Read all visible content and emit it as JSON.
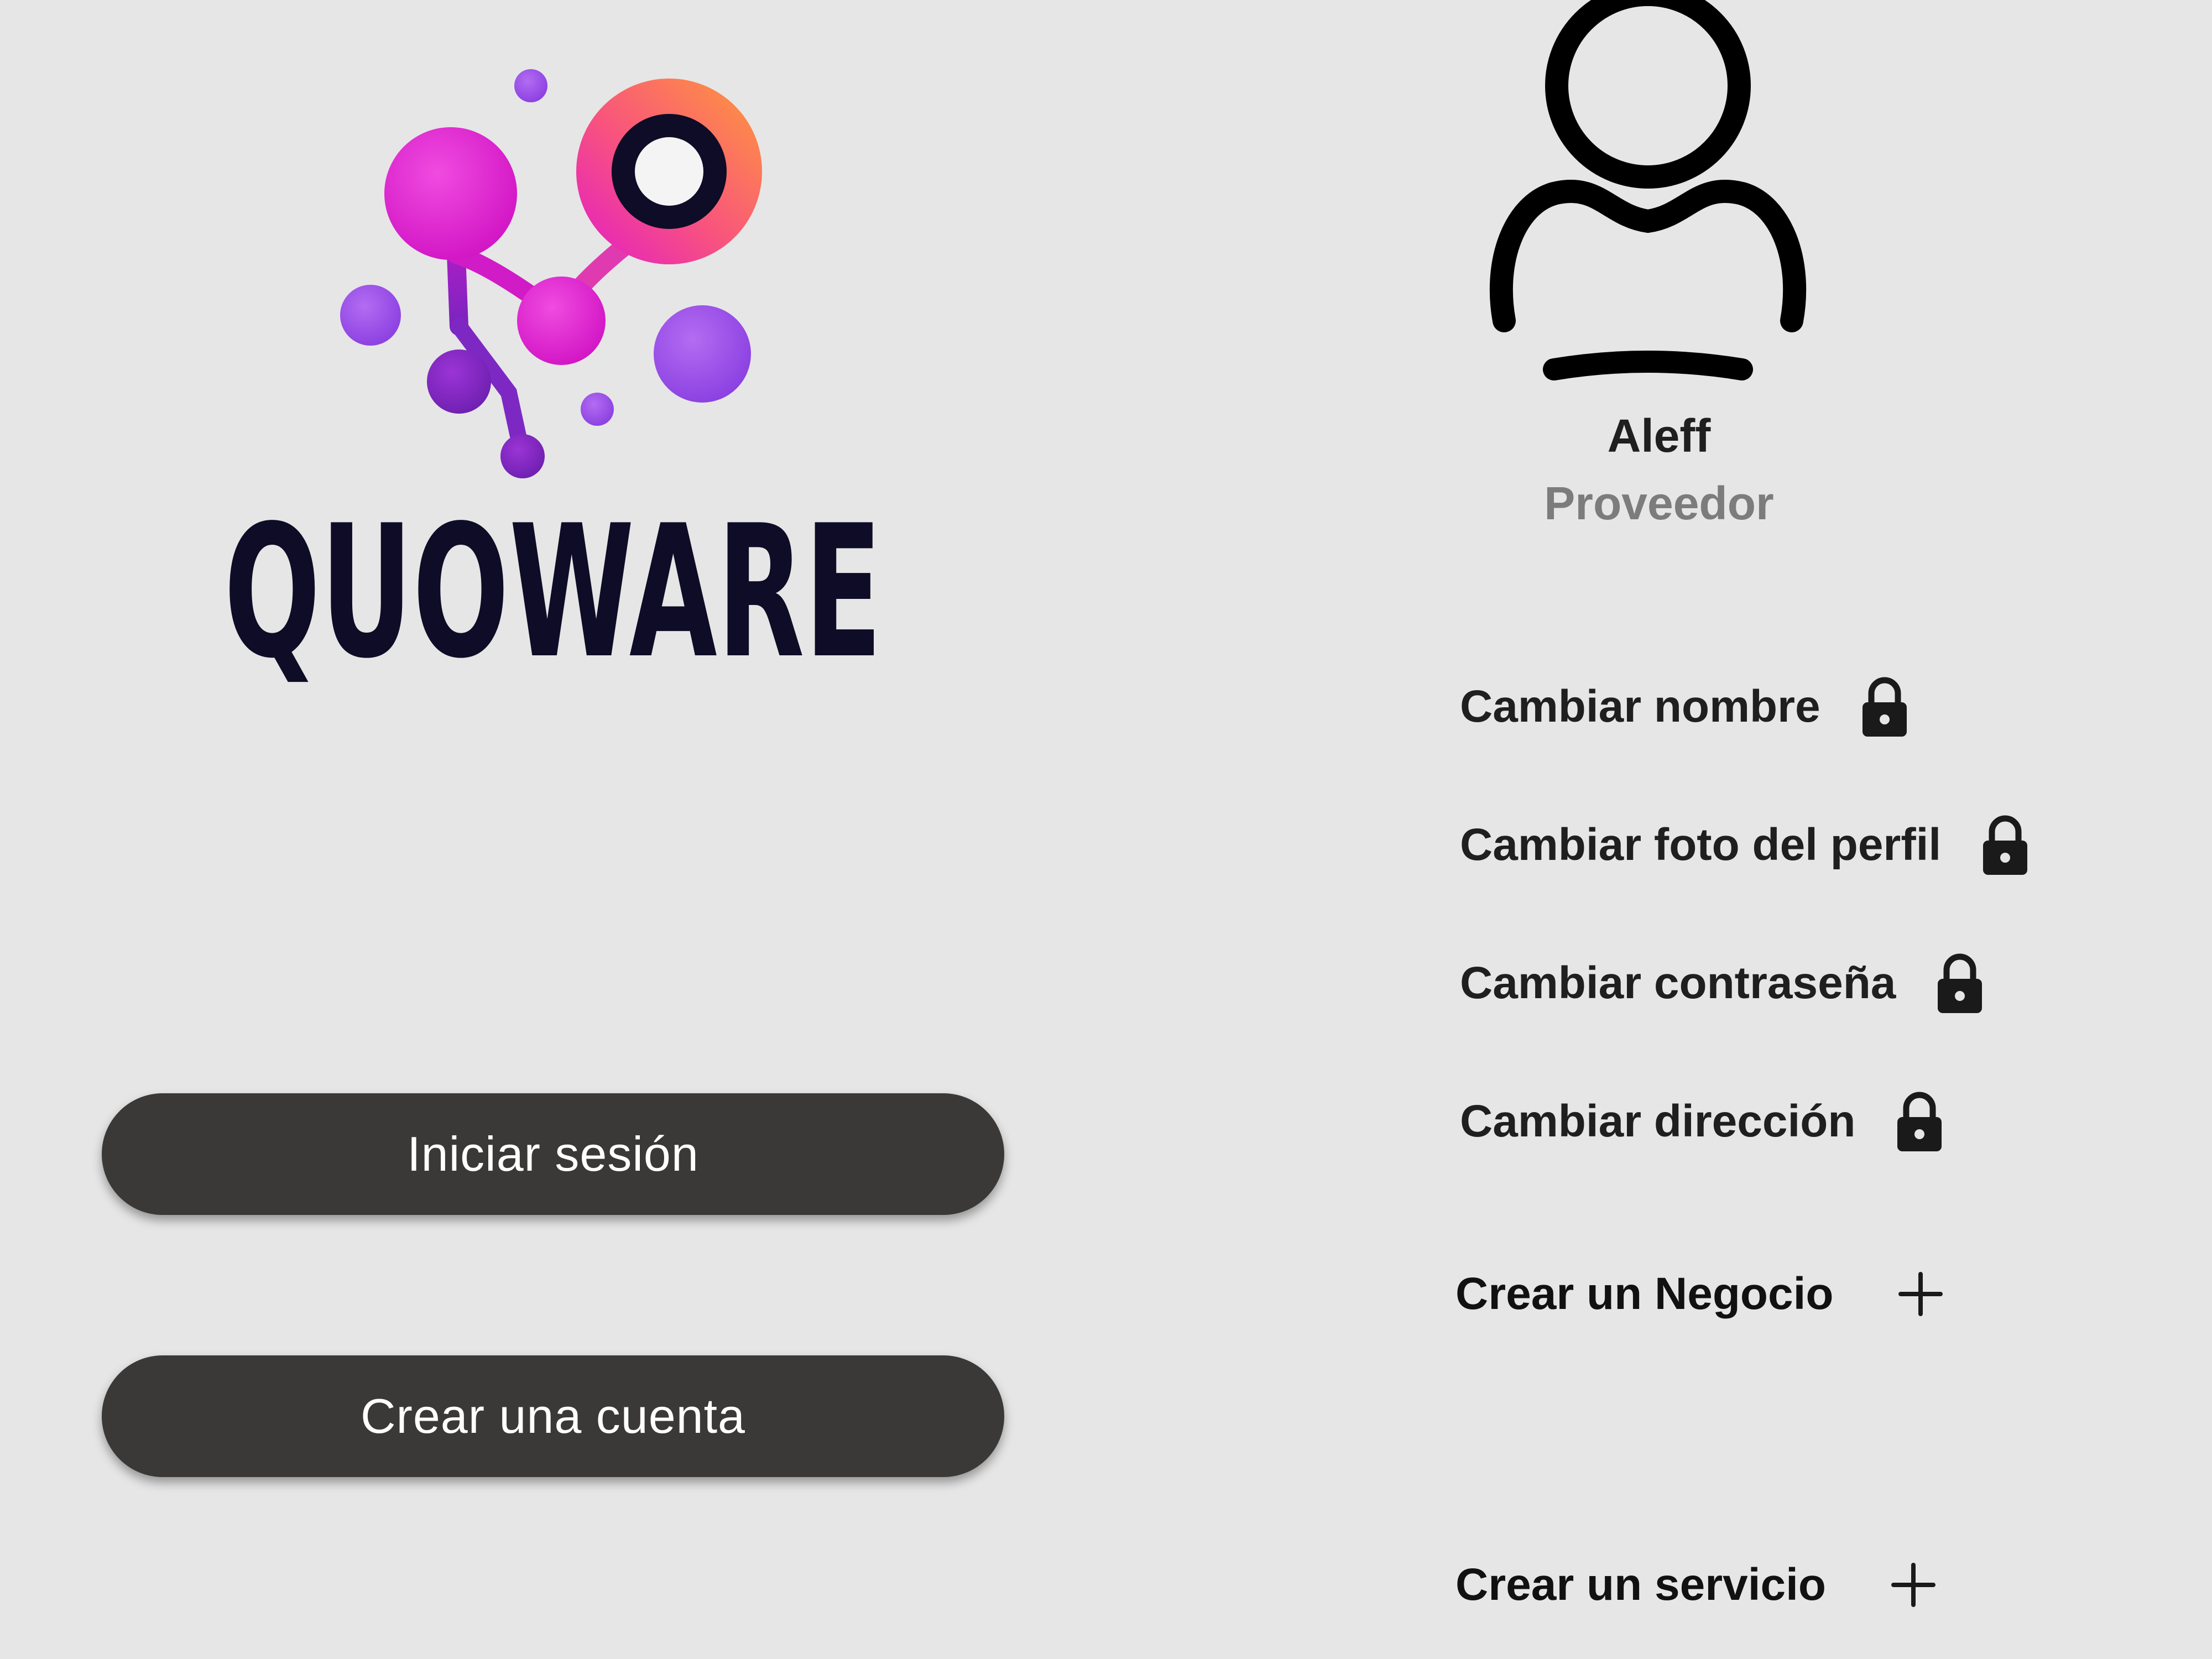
{
  "brand": {
    "name": "QUOWARE",
    "colors": {
      "magenta": "#e61ed2",
      "violet": "#9b3be8",
      "purple": "#8a2fd6",
      "orange": "#ff8a3a",
      "pink": "#f23aa8",
      "dark": "#0e0c26"
    }
  },
  "auth": {
    "login_label": "Iniciar sesión",
    "signup_label": "Crear una cuenta"
  },
  "profile": {
    "name": "Aleff",
    "role": "Proveedor",
    "avatar_icon": "user-avatar-icon"
  },
  "settings": {
    "items": [
      {
        "label": "Cambiar nombre",
        "icon": "lock-icon"
      },
      {
        "label": "Cambiar foto del perfil",
        "icon": "lock-icon"
      },
      {
        "label": "Cambiar contraseña",
        "icon": "lock-icon"
      },
      {
        "label": "Cambiar dirección",
        "icon": "lock-icon"
      }
    ]
  },
  "create": {
    "items": [
      {
        "label": "Crear un Negocio",
        "icon": "plus-icon"
      },
      {
        "label": "Crear un servicio",
        "icon": "plus-icon"
      }
    ]
  },
  "theme": {
    "background": "#e6e6e6",
    "button_bg": "#3a3937",
    "button_text": "#ffffff",
    "text_primary": "#1f1f1f",
    "text_secondary": "#7c7c7c"
  }
}
